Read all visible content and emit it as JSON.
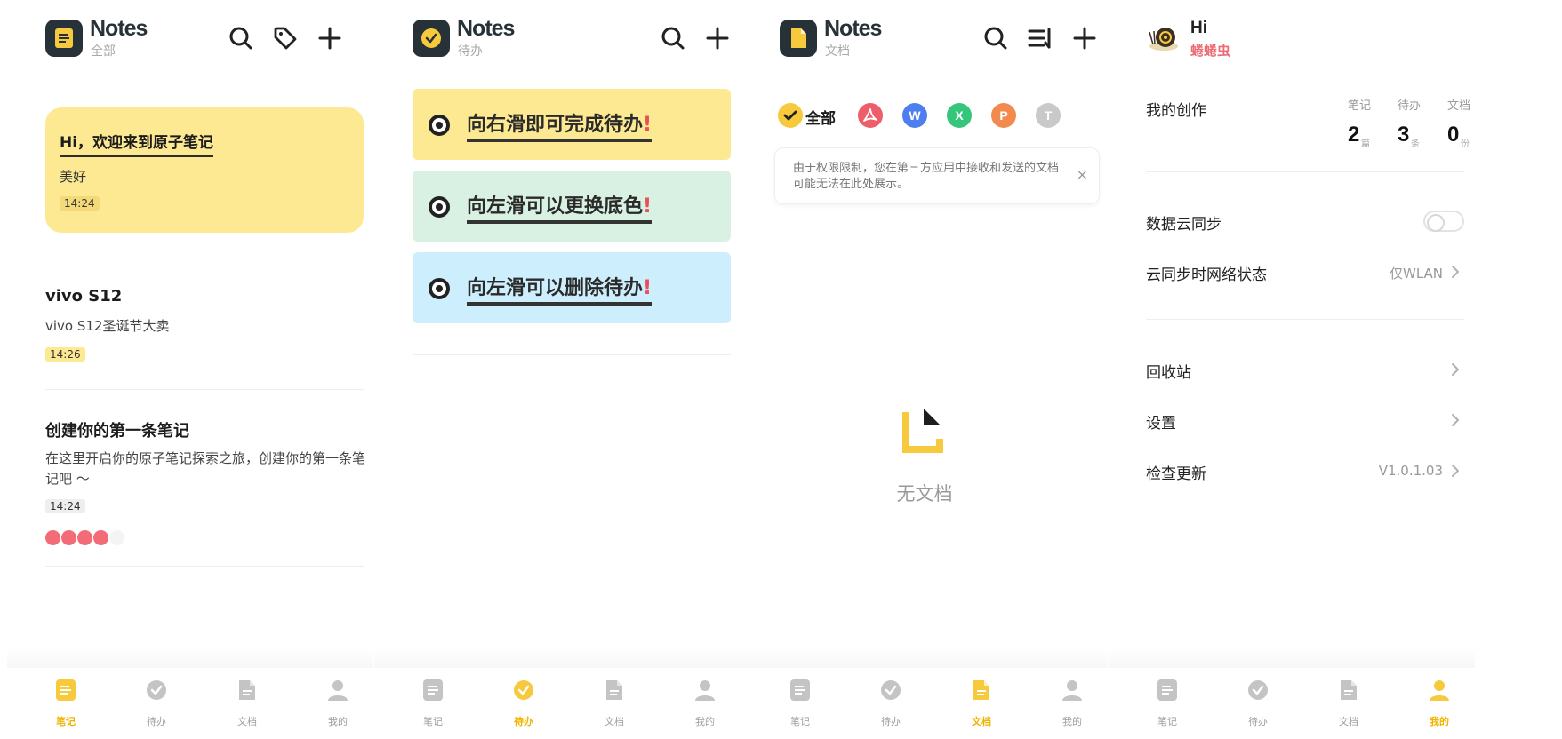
{
  "app_title": "Notes",
  "colors": {
    "yellow": "#fde992",
    "green": "#d9f1e3",
    "blue": "#cdeefc",
    "accent": "#f7c93d",
    "red": "#ef6b73"
  },
  "tabs": [
    {
      "label": "笔记",
      "icon": "note-icon"
    },
    {
      "label": "待办",
      "icon": "check-icon"
    },
    {
      "label": "文档",
      "icon": "document-icon"
    },
    {
      "label": "我的",
      "icon": "person-icon"
    }
  ],
  "notes_screen": {
    "subtitle": "全部",
    "notes": [
      {
        "title": "Hi，欢迎来到原子笔记",
        "body": "美好",
        "time": "14:24"
      },
      {
        "title": "vivo  S12",
        "body": "vivo  S12圣诞节大卖",
        "time": "14:26"
      },
      {
        "title": "创建你的第一条笔记",
        "body": "在这里开启你的原子笔记探索之旅，创建你的第一条笔记吧 ～",
        "time": "14:24"
      }
    ]
  },
  "todo_screen": {
    "subtitle": "待办",
    "items": [
      {
        "text": "向右滑即可完成待办",
        "mark": "!"
      },
      {
        "text": "向左滑可以更换底色",
        "mark": "!"
      },
      {
        "text": "向左滑可以删除待办",
        "mark": "!"
      }
    ]
  },
  "doc_screen": {
    "subtitle": "文档",
    "filters": [
      {
        "label": "全部",
        "icon": "check-icon",
        "color": "#f7c93d"
      },
      {
        "label": "",
        "icon": "pdf-icon",
        "color": "#ee5d6a"
      },
      {
        "label": "W",
        "icon": "word-icon",
        "color": "#4d7ff0"
      },
      {
        "label": "X",
        "icon": "excel-icon",
        "color": "#34c77b"
      },
      {
        "label": "P",
        "icon": "ppt-icon",
        "color": "#f28a4e"
      },
      {
        "label": "T",
        "icon": "text-icon",
        "color": "#c9c9c9"
      }
    ],
    "notice": "由于权限限制，您在第三方应用中接收和发送的文档可能无法在此处展示。",
    "notice_close": "×",
    "empty": "无文档"
  },
  "mine_screen": {
    "greeting": "Hi",
    "username": "蜷蜷虫",
    "creation_title": "我的创作",
    "stats": [
      {
        "label": "笔记",
        "value": "2",
        "unit": "篇"
      },
      {
        "label": "待办",
        "value": "3",
        "unit": "条"
      },
      {
        "label": "文档",
        "value": "0",
        "unit": "份"
      }
    ],
    "cloud_sync": "数据云同步",
    "network_label": "云同步时网络状态",
    "network_value": "仅WLAN",
    "trash": "回收站",
    "settings": "设置",
    "update_label": "检查更新",
    "update_value": "V1.0.1.03"
  }
}
